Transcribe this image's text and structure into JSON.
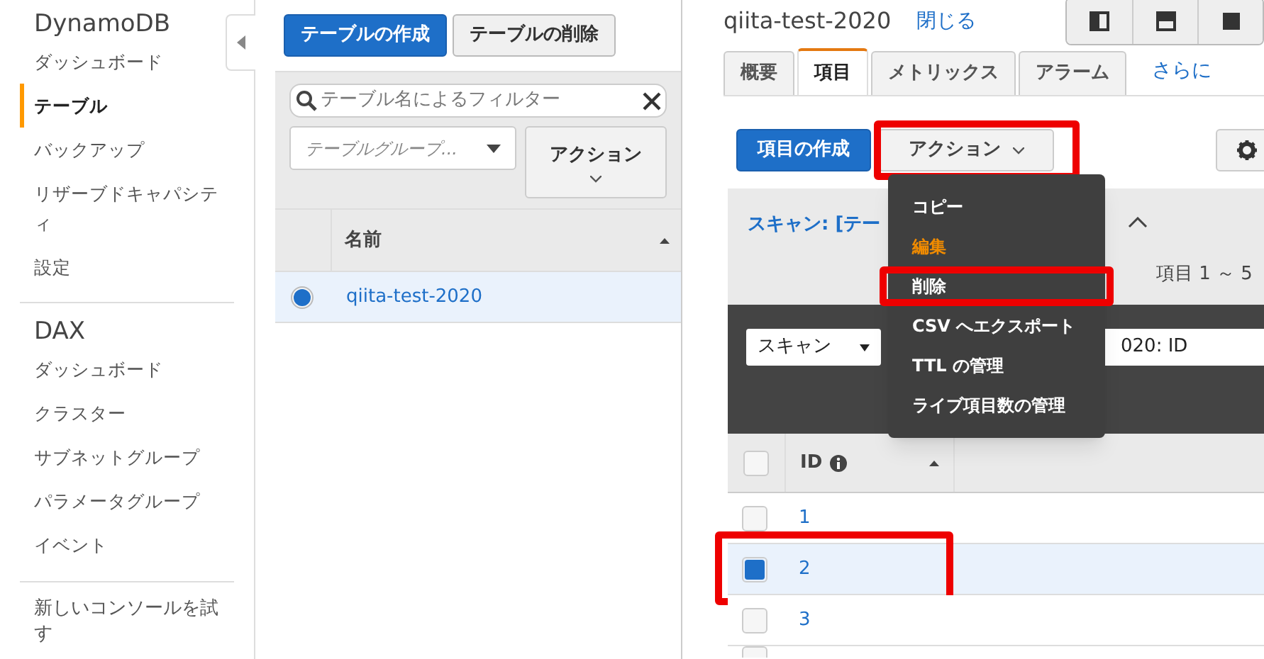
{
  "sidebar": {
    "sections": [
      {
        "title": "DynamoDB",
        "items": [
          {
            "label": "ダッシュボード",
            "selected": false
          },
          {
            "label": "テーブル",
            "selected": true
          },
          {
            "label": "バックアップ",
            "selected": false
          },
          {
            "label": "リザーブドキャパシティ",
            "selected": false
          },
          {
            "label": "設定",
            "selected": false
          }
        ]
      },
      {
        "title": "DAX",
        "items": [
          {
            "label": "ダッシュボード",
            "selected": false
          },
          {
            "label": "クラスター",
            "selected": false
          },
          {
            "label": "サブネットグループ",
            "selected": false
          },
          {
            "label": "パラメータグループ",
            "selected": false
          },
          {
            "label": "イベント",
            "selected": false
          }
        ]
      }
    ],
    "footer_link": "新しいコンソールを試す"
  },
  "tables_panel": {
    "buttons": [
      {
        "label": "テーブルの作成",
        "kind": "primary"
      },
      {
        "label": "テーブルの削除",
        "kind": "secondary"
      }
    ],
    "filter": {
      "placeholder": "テーブル名によるフィルター"
    },
    "group_select": {
      "placeholder": "テーブルグループ..."
    },
    "actions_button": "アクション",
    "column": "名前",
    "rows": [
      {
        "name": "qiita-test-2020",
        "selected": true
      }
    ]
  },
  "detail": {
    "title": "qiita-test-2020",
    "close_link": "閉じる",
    "tabs": [
      {
        "label": "概要",
        "selected": false
      },
      {
        "label": "項目",
        "selected": true
      },
      {
        "label": "メトリックス",
        "selected": false
      },
      {
        "label": "アラーム",
        "selected": false
      }
    ],
    "more_tabs": "さらに",
    "create_button": "項目の作成",
    "actions_button": {
      "label": "アクション",
      "highlighted": true
    },
    "scan_summary": "スキャン: [テー",
    "item_count": "項目 1 ～ 5",
    "scan_select": "スキャン",
    "table_field": "020: ID",
    "actions_menu": [
      {
        "label": "コピー",
        "kind": "normal",
        "highlighted": false
      },
      {
        "label": "編集",
        "kind": "accent",
        "highlighted": false
      },
      {
        "label": "削除",
        "kind": "normal",
        "highlighted": true
      },
      {
        "label": "CSV へエクスポート",
        "kind": "normal",
        "highlighted": false
      },
      {
        "label": "TTL の管理",
        "kind": "normal",
        "highlighted": false
      },
      {
        "label": "ライブ項目数の管理",
        "kind": "normal",
        "highlighted": false
      }
    ],
    "column": "ID",
    "select_all": {
      "checked": false
    },
    "next_row": {
      "checked": false
    },
    "rows": [
      {
        "id": "1",
        "checked": false,
        "highlighted": false
      },
      {
        "id": "2",
        "checked": true,
        "highlighted": true
      },
      {
        "id": "3",
        "checked": false,
        "highlighted": false
      }
    ]
  }
}
